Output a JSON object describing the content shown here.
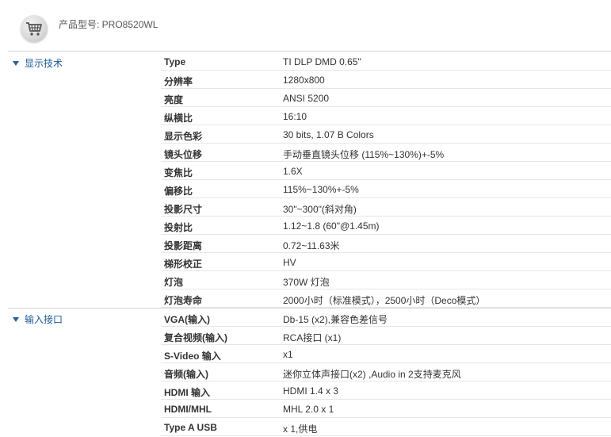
{
  "header": {
    "cart_icon": "shopping-cart-icon",
    "model_label": "产品型号: PRO8520WL"
  },
  "sections": [
    {
      "title": "显示技术",
      "rows": [
        {
          "k": "Type",
          "v": "TI DLP DMD 0.65\""
        },
        {
          "k": "分辨率",
          "v": "1280x800"
        },
        {
          "k": "亮度",
          "v": "ANSI 5200"
        },
        {
          "k": "纵横比",
          "v": "16:10"
        },
        {
          "k": "显示色彩",
          "v": "30 bits, 1.07 B Colors"
        },
        {
          "k": "镜头位移",
          "v": "手动垂直镜头位移 (115%~130%)+-5%"
        },
        {
          "k": "变焦比",
          "v": "1.6X"
        },
        {
          "k": "偏移比",
          "v": "115%~130%+-5%"
        },
        {
          "k": "投影尺寸",
          "v": "30\"~300\"(斜对角)"
        },
        {
          "k": "投射比",
          "v": "1.12~1.8 (60\"@1.45m)"
        },
        {
          "k": "投影距离",
          "v": "0.72~11.63米"
        },
        {
          "k": "梯形校正",
          "v": "HV"
        },
        {
          "k": "灯泡",
          "v": "370W 灯泡"
        },
        {
          "k": "灯泡寿命",
          "v": "2000小时（标准模式），2500小时（Deco模式）"
        }
      ]
    },
    {
      "title": "输入接口",
      "rows": [
        {
          "k": "VGA(输入)",
          "v": "Db-15 (x2),兼容色差信号"
        },
        {
          "k": "复合视频(输入)",
          "v": "RCA接口 (x1)"
        },
        {
          "k": "S-Video 输入",
          "v": "x1"
        },
        {
          "k": "音频(输入)",
          "v": "迷你立体声接口(x2) ,Audio in 2支持麦克风"
        },
        {
          "k": "HDMI 输入",
          "v": "HDMI 1.4 x 3"
        },
        {
          "k": "HDMI/MHL",
          "v": "MHL 2.0 x 1"
        },
        {
          "k": "Type A USB",
          "v": "x 1,供电"
        }
      ]
    }
  ]
}
